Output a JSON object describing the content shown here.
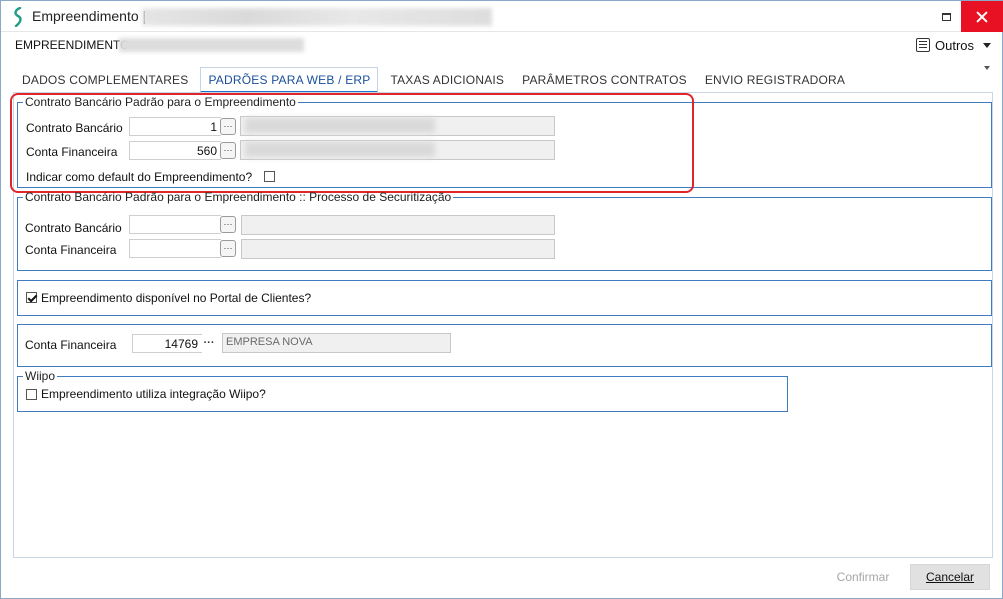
{
  "window": {
    "title": "Empreendimento |",
    "accent_color": "#3e7bc1",
    "close_color": "#e81123"
  },
  "header": {
    "entity_label": "EMPREENDIMENTO",
    "outros_label": "Outros",
    "outros_icon": "list-icon"
  },
  "tabs": [
    {
      "label": "DADOS COMPLEMENTARES",
      "active": false
    },
    {
      "label": "PADRÕES PARA WEB / ERP",
      "active": true
    },
    {
      "label": "TAXAS ADICIONAIS",
      "active": false
    },
    {
      "label": "PARÂMETROS CONTRATOS",
      "active": false
    },
    {
      "label": "ENVIO REGISTRADORA",
      "active": false
    }
  ],
  "group_default": {
    "legend": "Contrato Bancário Padrão para o Empreendimento",
    "contrato_label": "Contrato Bancário",
    "contrato_value": "1",
    "conta_label": "Conta Financeira",
    "conta_value": "560",
    "default_label": "Indicar como default do Empreendimento?",
    "default_checked": false,
    "highlight_color": "#e0252b"
  },
  "group_securitizacao": {
    "legend": "Contrato Bancário Padrão para o Empreendimento :: Processo de Securitização",
    "contrato_label": "Contrato Bancário",
    "contrato_value": "",
    "conta_label": "Conta Financeira",
    "conta_value": ""
  },
  "portal": {
    "label": "Empreendimento disponível no Portal de Clientes?",
    "checked": true
  },
  "conta_financeira": {
    "label": "Conta Financeira",
    "value": "14769",
    "description": "EMPRESA NOVA"
  },
  "wiipo": {
    "legend": "Wiipo",
    "label": "Empreendimento utiliza integração Wiipo?",
    "checked": false
  },
  "footer": {
    "confirm_label": "Confirmar",
    "cancel_label": "Cancelar"
  }
}
